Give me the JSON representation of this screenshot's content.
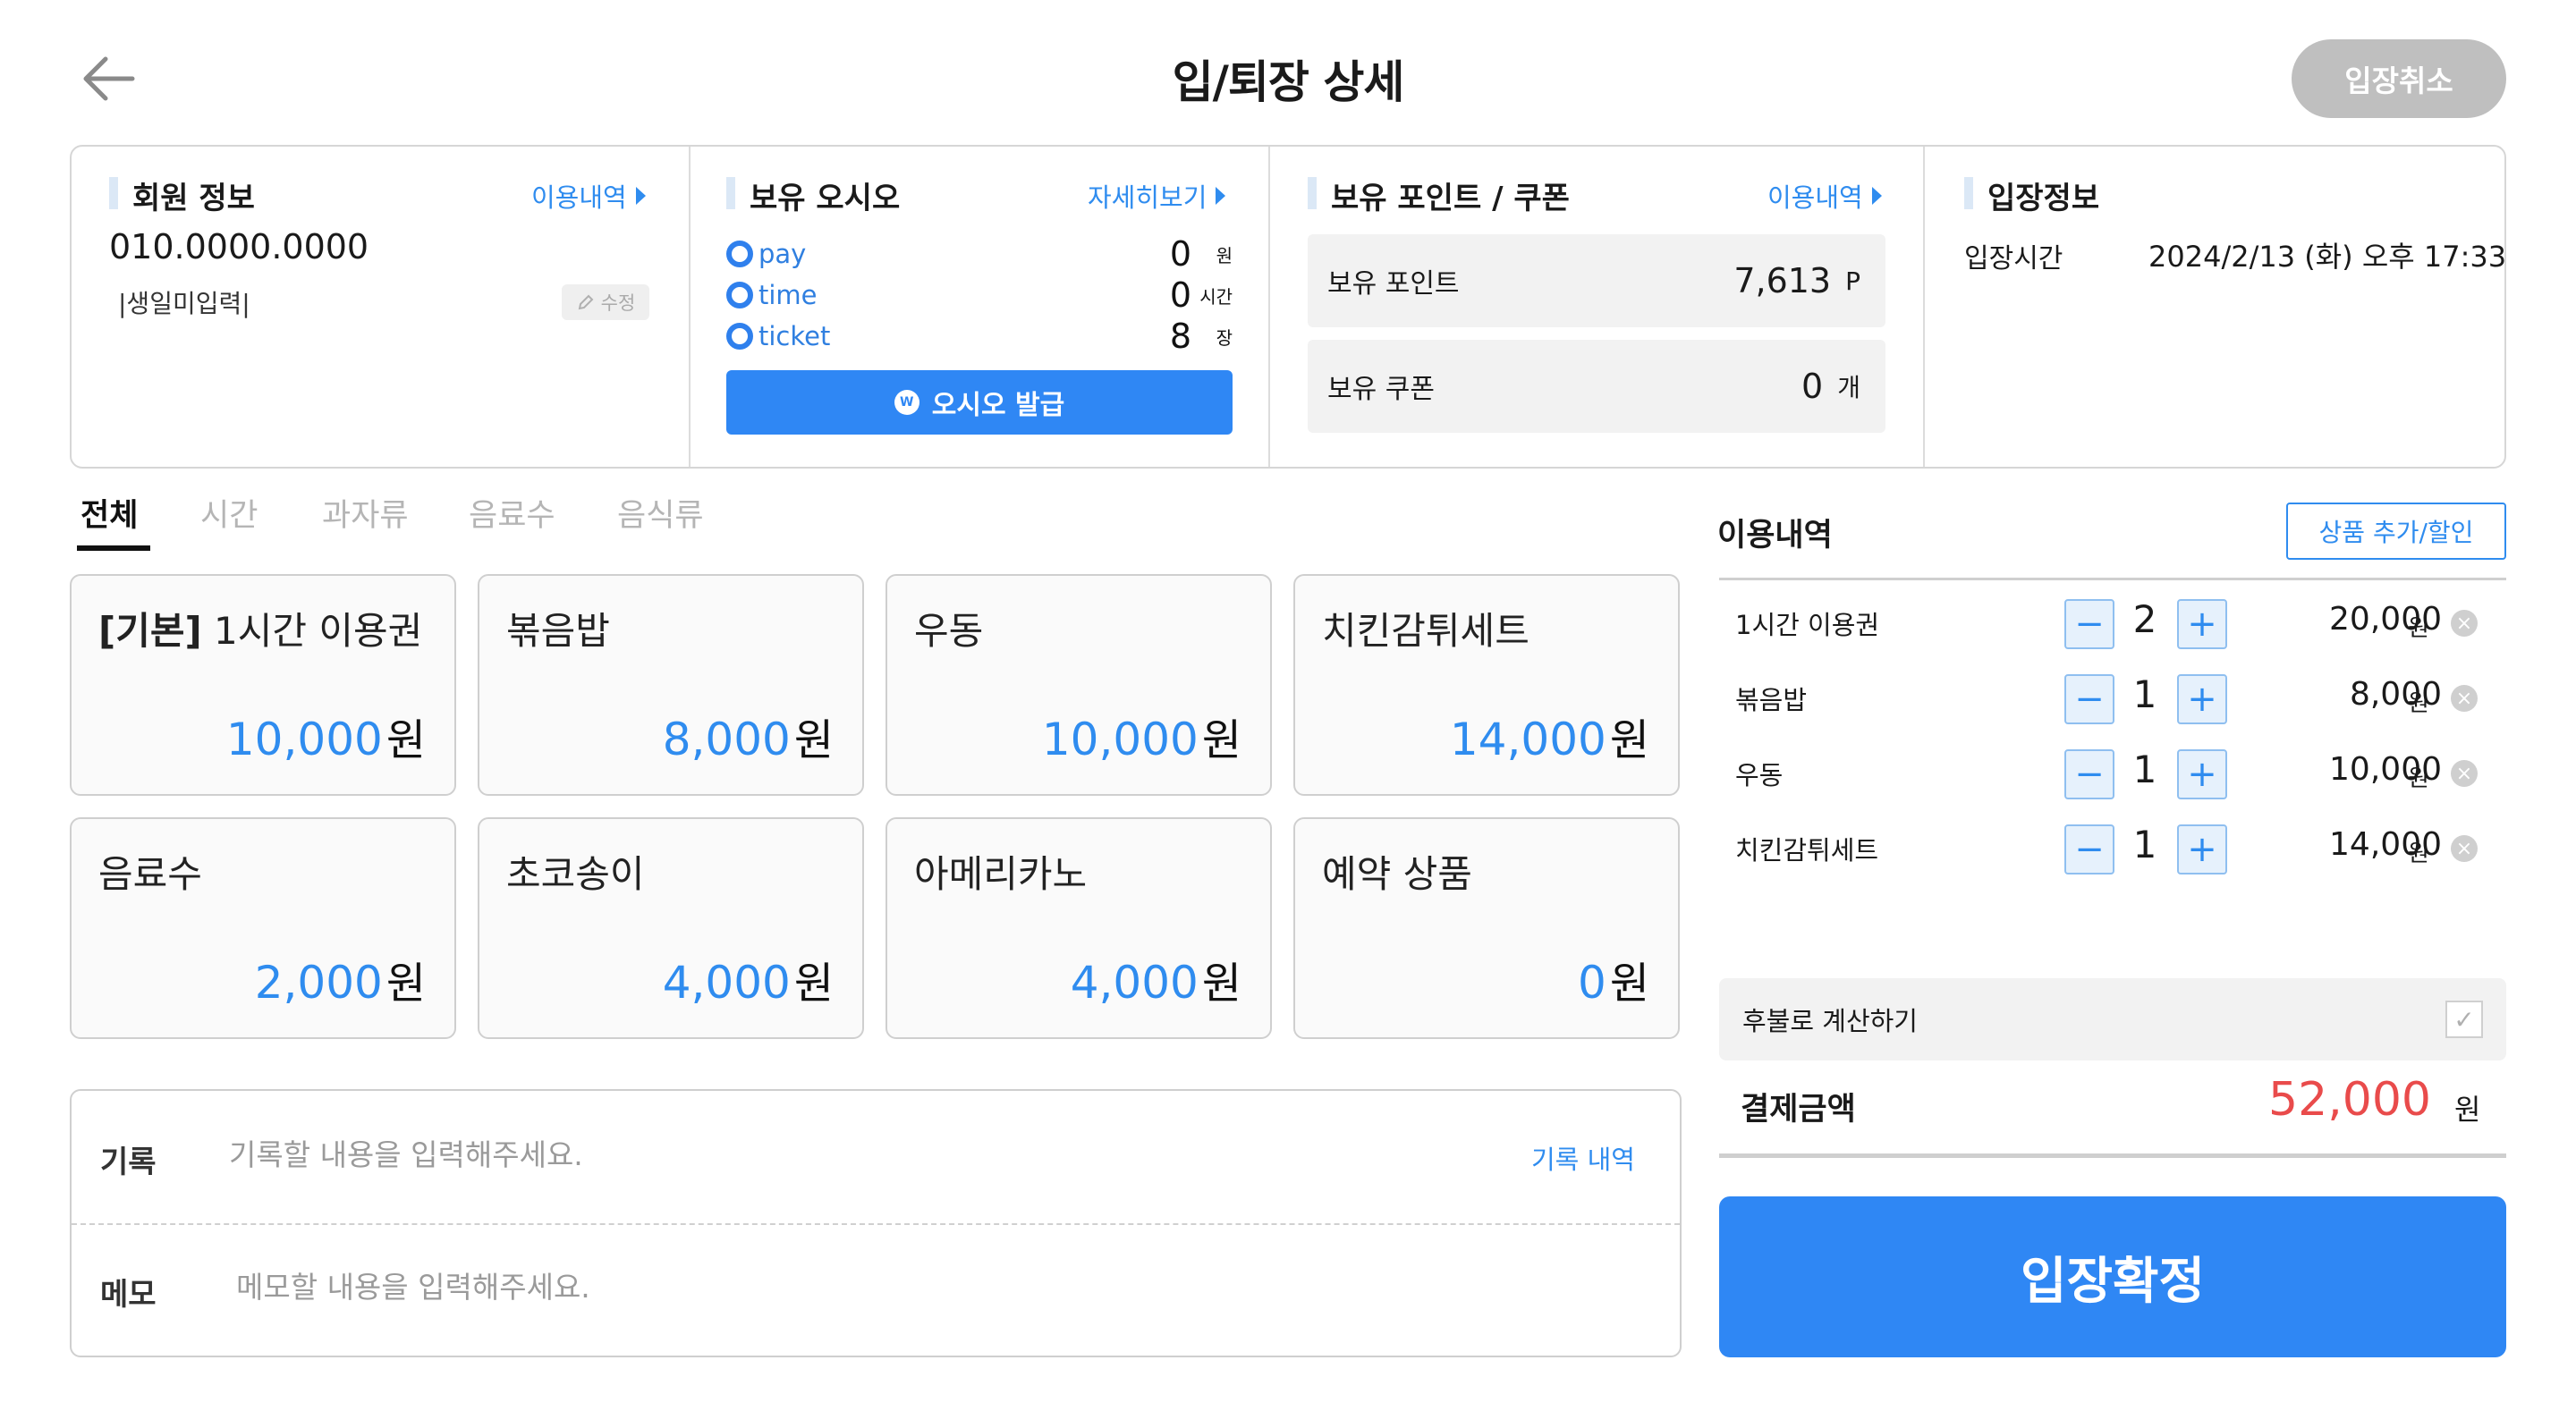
{
  "header": {
    "title": "입/퇴장 상세",
    "cancel_label": "입장취소"
  },
  "member": {
    "title": "회원 정보",
    "history_link": "이용내역",
    "phone": "010.0000.0000",
    "birthday": "|생일미입력|",
    "edit_label": "수정"
  },
  "osio": {
    "title": "보유 오시오",
    "detail_link": "자세히보기",
    "rows": [
      {
        "name": "pay",
        "value": "0",
        "unit": "원"
      },
      {
        "name": "time",
        "value": "0",
        "unit": "시간"
      },
      {
        "name": "ticket",
        "value": "8",
        "unit": "장"
      }
    ],
    "coin_symbol": "W",
    "issue_label": "오시오 발급"
  },
  "points": {
    "title": "보유 포인트 / 쿠폰",
    "history_link": "이용내역",
    "point_label": "보유 포인트",
    "point_value": "7,613",
    "point_unit": "P",
    "coupon_label": "보유 쿠폰",
    "coupon_value": "0",
    "coupon_unit": "개"
  },
  "entry": {
    "title": "입장정보",
    "time_label": "입장시간",
    "time_value": "2024/2/13 (화) 오후 17:33"
  },
  "tabs": [
    {
      "label": "전체",
      "active": true
    },
    {
      "label": "시간",
      "active": false
    },
    {
      "label": "과자류",
      "active": false
    },
    {
      "label": "음료수",
      "active": false
    },
    {
      "label": "음식류",
      "active": false
    }
  ],
  "products": [
    {
      "prefix": "[기본]",
      "name": "1시간 이용권",
      "price": "10,000",
      "unit": "원"
    },
    {
      "prefix": "",
      "name": "볶음밥",
      "price": "8,000",
      "unit": "원"
    },
    {
      "prefix": "",
      "name": "우동",
      "price": "10,000",
      "unit": "원"
    },
    {
      "prefix": "",
      "name": "치킨감튀세트",
      "price": "14,000",
      "unit": "원"
    },
    {
      "prefix": "",
      "name": "음료수",
      "price": "2,000",
      "unit": "원"
    },
    {
      "prefix": "",
      "name": "초코송이",
      "price": "4,000",
      "unit": "원"
    },
    {
      "prefix": "",
      "name": "아메리카노",
      "price": "4,000",
      "unit": "원"
    },
    {
      "prefix": "",
      "name": "예약 상품",
      "price": "0",
      "unit": "원"
    }
  ],
  "record": {
    "label": "기록",
    "placeholder": "기록할 내용을 입력해주세요.",
    "history_link": "기록 내역"
  },
  "memo": {
    "label": "메모",
    "placeholder": "메모할 내용을 입력해주세요."
  },
  "usage": {
    "title": "이용내역",
    "add_label": "상품 추가/할인",
    "items": [
      {
        "name": "1시간 이용권",
        "qty": "2",
        "price": "20,000",
        "unit": "원"
      },
      {
        "name": "볶음밥",
        "qty": "1",
        "price": "8,000",
        "unit": "원"
      },
      {
        "name": "우동",
        "qty": "1",
        "price": "10,000",
        "unit": "원"
      },
      {
        "name": "치킨감튀세트",
        "qty": "1",
        "price": "14,000",
        "unit": "원"
      }
    ],
    "minus": "−",
    "plus": "+",
    "remove": "×"
  },
  "deferred": {
    "label": "후불로 계산하기",
    "check": "✓"
  },
  "payment": {
    "label": "결제금액",
    "amount": "52,000",
    "unit": "원",
    "confirm_label": "입장확정"
  },
  "colors": {
    "accent": "#2f87f4",
    "link": "#2f8cef",
    "total": "#e94b4b",
    "cancel": "#bfbfbf"
  }
}
